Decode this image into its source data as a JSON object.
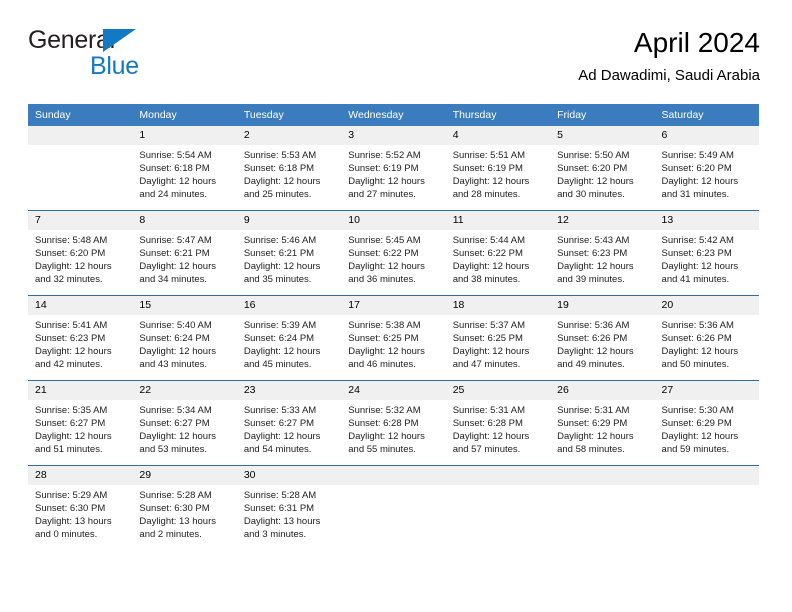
{
  "brand": {
    "name_part1": "General",
    "name_part2": "Blue",
    "triangle_color": "#1479c4",
    "text_color_dark": "#231f20",
    "text_color_blue": "#1479c4"
  },
  "header": {
    "title": "April 2024",
    "subtitle": "Ad Dawadimi, Saudi Arabia"
  },
  "theme": {
    "header_bg": "#3a7cbd",
    "header_text": "#ffffff",
    "row_divider": "#2f6da8",
    "daynum_bg": "#f0f0f0",
    "body_text": "#222222"
  },
  "weekdays": [
    "Sunday",
    "Monday",
    "Tuesday",
    "Wednesday",
    "Thursday",
    "Friday",
    "Saturday"
  ],
  "labels": {
    "sunrise": "Sunrise:",
    "sunset": "Sunset:",
    "daylight": "Daylight:"
  },
  "weeks": [
    [
      {
        "day": "",
        "sunrise": "",
        "sunset": "",
        "daylight_line1": "",
        "daylight_line2": "",
        "empty": true
      },
      {
        "day": "1",
        "sunrise": "Sunrise: 5:54 AM",
        "sunset": "Sunset: 6:18 PM",
        "daylight_line1": "Daylight: 12 hours",
        "daylight_line2": "and 24 minutes.",
        "empty": false
      },
      {
        "day": "2",
        "sunrise": "Sunrise: 5:53 AM",
        "sunset": "Sunset: 6:18 PM",
        "daylight_line1": "Daylight: 12 hours",
        "daylight_line2": "and 25 minutes.",
        "empty": false
      },
      {
        "day": "3",
        "sunrise": "Sunrise: 5:52 AM",
        "sunset": "Sunset: 6:19 PM",
        "daylight_line1": "Daylight: 12 hours",
        "daylight_line2": "and 27 minutes.",
        "empty": false
      },
      {
        "day": "4",
        "sunrise": "Sunrise: 5:51 AM",
        "sunset": "Sunset: 6:19 PM",
        "daylight_line1": "Daylight: 12 hours",
        "daylight_line2": "and 28 minutes.",
        "empty": false
      },
      {
        "day": "5",
        "sunrise": "Sunrise: 5:50 AM",
        "sunset": "Sunset: 6:20 PM",
        "daylight_line1": "Daylight: 12 hours",
        "daylight_line2": "and 30 minutes.",
        "empty": false
      },
      {
        "day": "6",
        "sunrise": "Sunrise: 5:49 AM",
        "sunset": "Sunset: 6:20 PM",
        "daylight_line1": "Daylight: 12 hours",
        "daylight_line2": "and 31 minutes.",
        "empty": false
      }
    ],
    [
      {
        "day": "7",
        "sunrise": "Sunrise: 5:48 AM",
        "sunset": "Sunset: 6:20 PM",
        "daylight_line1": "Daylight: 12 hours",
        "daylight_line2": "and 32 minutes.",
        "empty": false
      },
      {
        "day": "8",
        "sunrise": "Sunrise: 5:47 AM",
        "sunset": "Sunset: 6:21 PM",
        "daylight_line1": "Daylight: 12 hours",
        "daylight_line2": "and 34 minutes.",
        "empty": false
      },
      {
        "day": "9",
        "sunrise": "Sunrise: 5:46 AM",
        "sunset": "Sunset: 6:21 PM",
        "daylight_line1": "Daylight: 12 hours",
        "daylight_line2": "and 35 minutes.",
        "empty": false
      },
      {
        "day": "10",
        "sunrise": "Sunrise: 5:45 AM",
        "sunset": "Sunset: 6:22 PM",
        "daylight_line1": "Daylight: 12 hours",
        "daylight_line2": "and 36 minutes.",
        "empty": false
      },
      {
        "day": "11",
        "sunrise": "Sunrise: 5:44 AM",
        "sunset": "Sunset: 6:22 PM",
        "daylight_line1": "Daylight: 12 hours",
        "daylight_line2": "and 38 minutes.",
        "empty": false
      },
      {
        "day": "12",
        "sunrise": "Sunrise: 5:43 AM",
        "sunset": "Sunset: 6:23 PM",
        "daylight_line1": "Daylight: 12 hours",
        "daylight_line2": "and 39 minutes.",
        "empty": false
      },
      {
        "day": "13",
        "sunrise": "Sunrise: 5:42 AM",
        "sunset": "Sunset: 6:23 PM",
        "daylight_line1": "Daylight: 12 hours",
        "daylight_line2": "and 41 minutes.",
        "empty": false
      }
    ],
    [
      {
        "day": "14",
        "sunrise": "Sunrise: 5:41 AM",
        "sunset": "Sunset: 6:23 PM",
        "daylight_line1": "Daylight: 12 hours",
        "daylight_line2": "and 42 minutes.",
        "empty": false
      },
      {
        "day": "15",
        "sunrise": "Sunrise: 5:40 AM",
        "sunset": "Sunset: 6:24 PM",
        "daylight_line1": "Daylight: 12 hours",
        "daylight_line2": "and 43 minutes.",
        "empty": false
      },
      {
        "day": "16",
        "sunrise": "Sunrise: 5:39 AM",
        "sunset": "Sunset: 6:24 PM",
        "daylight_line1": "Daylight: 12 hours",
        "daylight_line2": "and 45 minutes.",
        "empty": false
      },
      {
        "day": "17",
        "sunrise": "Sunrise: 5:38 AM",
        "sunset": "Sunset: 6:25 PM",
        "daylight_line1": "Daylight: 12 hours",
        "daylight_line2": "and 46 minutes.",
        "empty": false
      },
      {
        "day": "18",
        "sunrise": "Sunrise: 5:37 AM",
        "sunset": "Sunset: 6:25 PM",
        "daylight_line1": "Daylight: 12 hours",
        "daylight_line2": "and 47 minutes.",
        "empty": false
      },
      {
        "day": "19",
        "sunrise": "Sunrise: 5:36 AM",
        "sunset": "Sunset: 6:26 PM",
        "daylight_line1": "Daylight: 12 hours",
        "daylight_line2": "and 49 minutes.",
        "empty": false
      },
      {
        "day": "20",
        "sunrise": "Sunrise: 5:36 AM",
        "sunset": "Sunset: 6:26 PM",
        "daylight_line1": "Daylight: 12 hours",
        "daylight_line2": "and 50 minutes.",
        "empty": false
      }
    ],
    [
      {
        "day": "21",
        "sunrise": "Sunrise: 5:35 AM",
        "sunset": "Sunset: 6:27 PM",
        "daylight_line1": "Daylight: 12 hours",
        "daylight_line2": "and 51 minutes.",
        "empty": false
      },
      {
        "day": "22",
        "sunrise": "Sunrise: 5:34 AM",
        "sunset": "Sunset: 6:27 PM",
        "daylight_line1": "Daylight: 12 hours",
        "daylight_line2": "and 53 minutes.",
        "empty": false
      },
      {
        "day": "23",
        "sunrise": "Sunrise: 5:33 AM",
        "sunset": "Sunset: 6:27 PM",
        "daylight_line1": "Daylight: 12 hours",
        "daylight_line2": "and 54 minutes.",
        "empty": false
      },
      {
        "day": "24",
        "sunrise": "Sunrise: 5:32 AM",
        "sunset": "Sunset: 6:28 PM",
        "daylight_line1": "Daylight: 12 hours",
        "daylight_line2": "and 55 minutes.",
        "empty": false
      },
      {
        "day": "25",
        "sunrise": "Sunrise: 5:31 AM",
        "sunset": "Sunset: 6:28 PM",
        "daylight_line1": "Daylight: 12 hours",
        "daylight_line2": "and 57 minutes.",
        "empty": false
      },
      {
        "day": "26",
        "sunrise": "Sunrise: 5:31 AM",
        "sunset": "Sunset: 6:29 PM",
        "daylight_line1": "Daylight: 12 hours",
        "daylight_line2": "and 58 minutes.",
        "empty": false
      },
      {
        "day": "27",
        "sunrise": "Sunrise: 5:30 AM",
        "sunset": "Sunset: 6:29 PM",
        "daylight_line1": "Daylight: 12 hours",
        "daylight_line2": "and 59 minutes.",
        "empty": false
      }
    ],
    [
      {
        "day": "28",
        "sunrise": "Sunrise: 5:29 AM",
        "sunset": "Sunset: 6:30 PM",
        "daylight_line1": "Daylight: 13 hours",
        "daylight_line2": "and 0 minutes.",
        "empty": false
      },
      {
        "day": "29",
        "sunrise": "Sunrise: 5:28 AM",
        "sunset": "Sunset: 6:30 PM",
        "daylight_line1": "Daylight: 13 hours",
        "daylight_line2": "and 2 minutes.",
        "empty": false
      },
      {
        "day": "30",
        "sunrise": "Sunrise: 5:28 AM",
        "sunset": "Sunset: 6:31 PM",
        "daylight_line1": "Daylight: 13 hours",
        "daylight_line2": "and 3 minutes.",
        "empty": false
      },
      {
        "day": "",
        "sunrise": "",
        "sunset": "",
        "daylight_line1": "",
        "daylight_line2": "",
        "empty": true
      },
      {
        "day": "",
        "sunrise": "",
        "sunset": "",
        "daylight_line1": "",
        "daylight_line2": "",
        "empty": true
      },
      {
        "day": "",
        "sunrise": "",
        "sunset": "",
        "daylight_line1": "",
        "daylight_line2": "",
        "empty": true
      },
      {
        "day": "",
        "sunrise": "",
        "sunset": "",
        "daylight_line1": "",
        "daylight_line2": "",
        "empty": true
      }
    ]
  ]
}
